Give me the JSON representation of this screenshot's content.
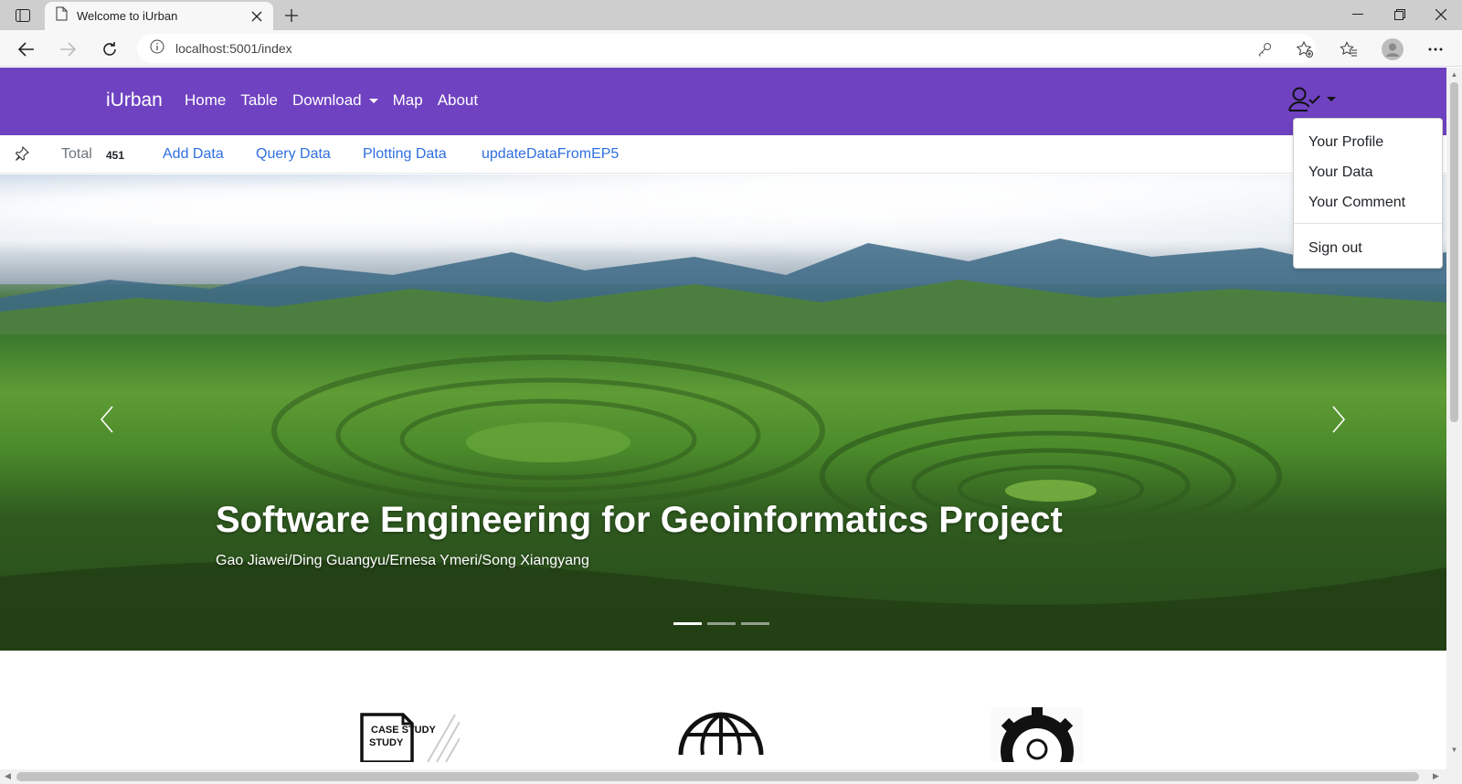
{
  "browser": {
    "tab_title": "Welcome to iUrban",
    "url": "localhost:5001/index"
  },
  "navbar": {
    "brand": "iUrban",
    "links": [
      "Home",
      "Table",
      "Download",
      "Map",
      "About"
    ],
    "bg_color": "#6f42c1"
  },
  "subbar": {
    "total_label": "Total",
    "total_count": "451",
    "links": [
      "Add Data",
      "Query Data",
      "Plotting Data",
      "updateDataFromEP5"
    ],
    "link_color": "#2f6fe0"
  },
  "carousel": {
    "title": "Software Engineering for Geoinformatics Project",
    "subtitle": "Gao Jiawei/Ding Guangyu/Ernesa Ymeri/Song Xiangyang",
    "indicator_count": 3,
    "active_indicator": 0
  },
  "features": [
    {
      "icon": "case-study-icon",
      "label": "CASE STUDY"
    },
    {
      "icon": "globe-www-icon",
      "label": ""
    },
    {
      "icon": "gear-person-icon",
      "label": ""
    }
  ],
  "user_menu": {
    "items": [
      "Your Profile",
      "Your Data",
      "Your Comment"
    ],
    "signout": "Sign out"
  }
}
